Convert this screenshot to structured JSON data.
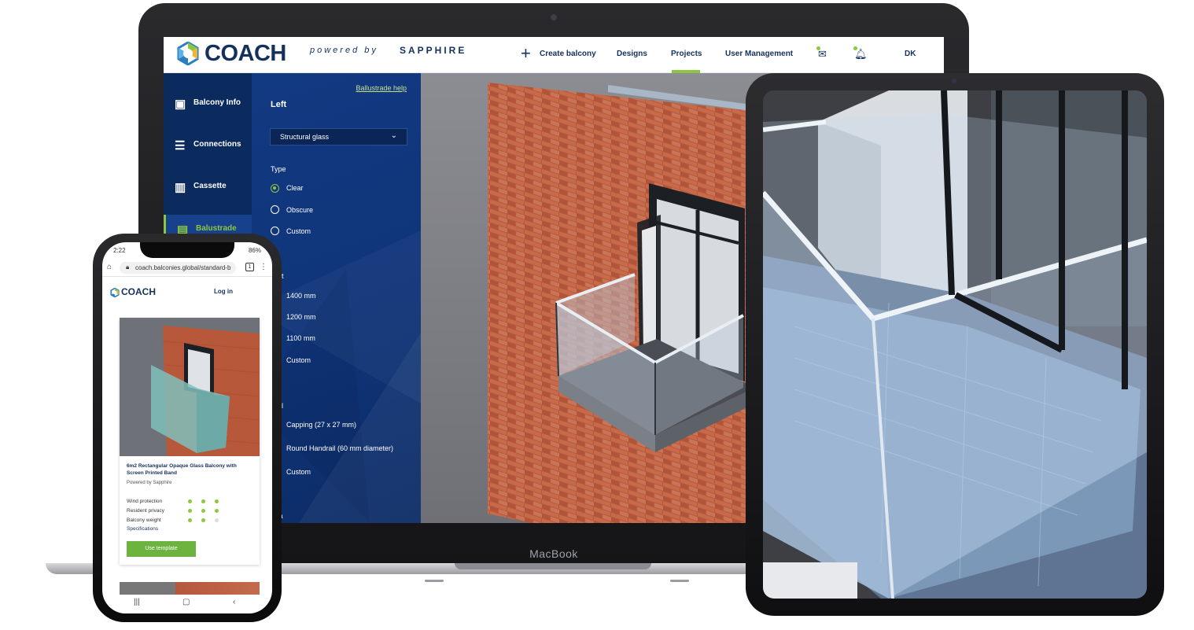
{
  "laptop": {
    "brand_label": "MacBook",
    "header": {
      "logo_text": "COACH",
      "powered_text": "powered by",
      "sapphire_text": "SAPPHIRE",
      "nav": {
        "create_balcony": "Create balcony",
        "designs": "Designs",
        "projects": "Projects",
        "user_management": "User Management",
        "language": "DK"
      },
      "active_nav": "Projects"
    },
    "rail": [
      {
        "label": "Balcony Info",
        "icon": "wallet-icon"
      },
      {
        "label": "Connections",
        "icon": "connections-icon"
      },
      {
        "label": "Cassette",
        "icon": "cassette-icon"
      },
      {
        "label": "Balustrade",
        "icon": "balustrade-icon",
        "active": true
      }
    ],
    "panel": {
      "help_link": "Ballustrade help",
      "side_title": "Left",
      "dropdown_value": "Structural glass",
      "type_label": "Type",
      "type_options": [
        "Clear",
        "Obscure",
        "Custom"
      ],
      "type_selected": "Clear",
      "height_label": "ght",
      "height_options": [
        "1400 mm",
        "1200 mm",
        "1100 mm",
        "Custom"
      ],
      "rail_label": "rail",
      "rail_options": [
        "Capping (27 x 27 mm)",
        "Round Handrail (60 mm diameter)",
        "Custom"
      ],
      "fascia_label": "cia"
    }
  },
  "phone": {
    "status_time": "2:22",
    "status_right": "86%",
    "url": "coach.balconies.global/standard-b",
    "tab_count": "1",
    "logo_text": "COACH",
    "login": "Log in",
    "card": {
      "title": "6m2 Rectangular Opaque Glass Balcony with Screen Printed Band",
      "subtitle": "Powered by Sapphire",
      "ratings": [
        {
          "label": "Wind protection",
          "value": 3,
          "max": 3
        },
        {
          "label": "Resident privacy",
          "value": 3,
          "max": 3
        },
        {
          "label": "Balcony weight",
          "value": 2,
          "max": 3
        }
      ],
      "spec_link": "Specifications",
      "button": "Use template"
    }
  },
  "colors": {
    "navy": "#14305c",
    "accent_green": "#8ec63f",
    "panel_blue": "#0f3478",
    "brick": "#b8583b"
  }
}
